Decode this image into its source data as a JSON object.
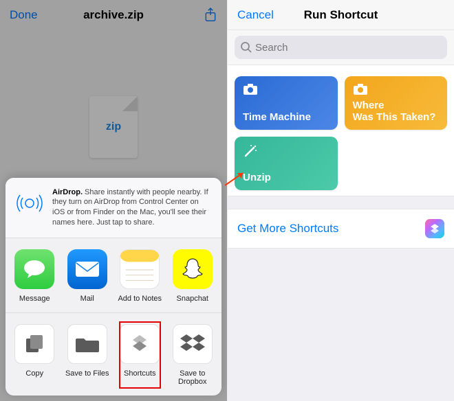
{
  "left": {
    "navbar": {
      "done": "Done",
      "title": "archive.zip"
    },
    "file_label": "zip",
    "airdrop": {
      "bold": "AirDrop.",
      "rest": " Share instantly with people nearby. If they turn on AirDrop from Control Center on iOS or from Finder on the Mac, you'll see their names here. Just tap to share."
    },
    "apps": {
      "message": "Message",
      "mail": "Mail",
      "notes": "Add to Notes",
      "snapchat": "Snapchat"
    },
    "actions": {
      "copy": "Copy",
      "save_files": "Save to Files",
      "shortcuts": "Shortcuts",
      "dropbox": "Save to Dropbox"
    }
  },
  "right": {
    "cancel": "Cancel",
    "title": "Run Shortcut",
    "search_placeholder": "Search",
    "cards": {
      "time_machine": "Time Machine",
      "where_taken": "Where\nWas This Taken?",
      "unzip": "Unzip"
    },
    "get_more": "Get More Shortcuts"
  }
}
